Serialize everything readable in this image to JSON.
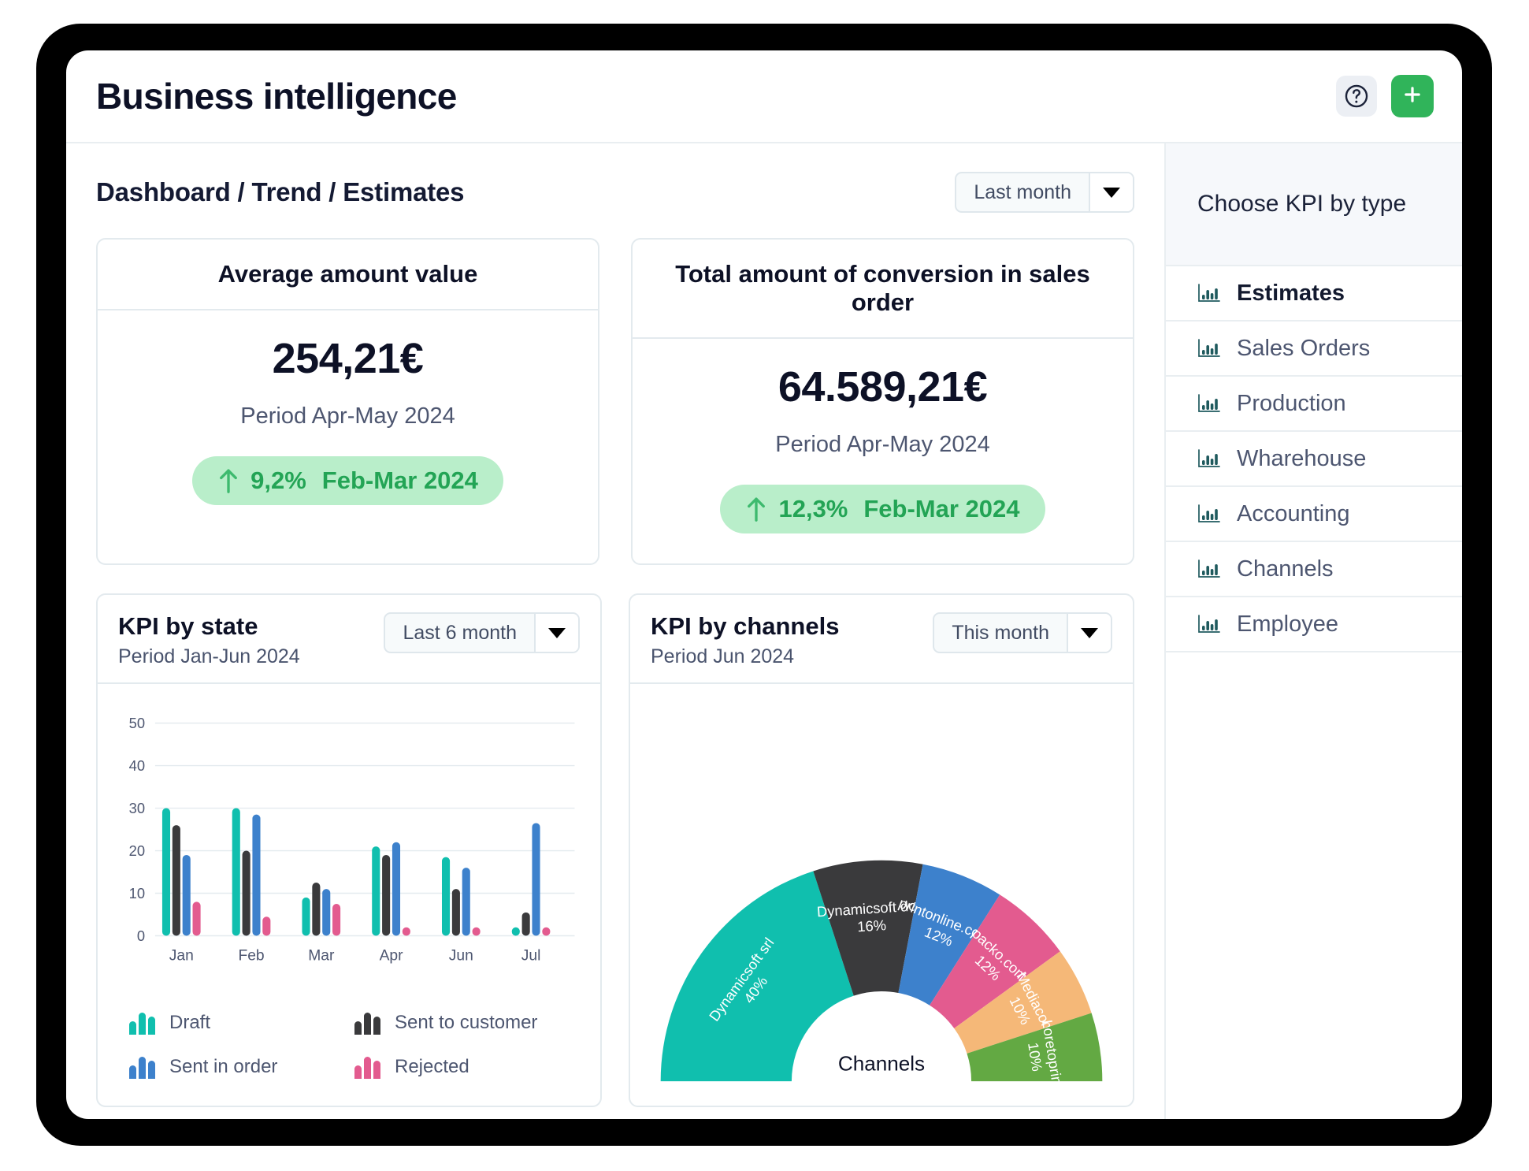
{
  "header": {
    "title": "Business intelligence",
    "help_icon": "question-circle-icon",
    "add_icon": "plus-icon"
  },
  "breadcrumb": "Dashboard / Trend / Estimates",
  "period_filter": {
    "value": "Last month",
    "arrow_icon": "chevron-down-icon"
  },
  "kpi_cards": [
    {
      "title": "Average amount value",
      "value": "254,21€",
      "period": "Period Apr-May 2024",
      "delta_pct": "9,2%",
      "delta_period": "Feb-Mar 2024",
      "delta_direction": "up",
      "delta_icon": "arrow-up-icon"
    },
    {
      "title": "Total amount of conversion in sales order",
      "value": "64.589,21€",
      "period": "Period Apr-May 2024",
      "delta_pct": "12,3%",
      "delta_period": "Feb-Mar 2024",
      "delta_direction": "up",
      "delta_icon": "arrow-up-icon"
    }
  ],
  "bar_card": {
    "title": "KPI by state",
    "subtitle": "Period Jan-Jun 2024",
    "filter": {
      "value": "Last 6 month",
      "arrow_icon": "chevron-down-icon"
    }
  },
  "donut_card": {
    "title": "KPI by channels",
    "subtitle": "Period Jun 2024",
    "filter": {
      "value": "This month",
      "arrow_icon": "chevron-down-icon"
    }
  },
  "sidebar": {
    "header": "Choose KPI by type",
    "items": [
      {
        "label": "Estimates",
        "icon": "bar-chart-icon",
        "active": true
      },
      {
        "label": "Sales Orders",
        "icon": "bar-chart-icon",
        "active": false
      },
      {
        "label": "Production",
        "icon": "bar-chart-icon",
        "active": false
      },
      {
        "label": "Wharehouse",
        "icon": "bar-chart-icon",
        "active": false
      },
      {
        "label": "Accounting",
        "icon": "bar-chart-icon",
        "active": false
      },
      {
        "label": "Channels",
        "icon": "bar-chart-icon",
        "active": false
      },
      {
        "label": "Employee",
        "icon": "bar-chart-icon",
        "active": false
      }
    ]
  },
  "colors": {
    "draft": "#10bfae",
    "sent_to_customer": "#3a3a3c",
    "sent_in_order": "#3d81cc",
    "rejected": "#e35b8f",
    "mediacom": "#f5b878",
    "loretoprint": "#63a943",
    "accent_green": "#30b45a",
    "badge_bg": "#b9eeca",
    "badge_text": "#23a455",
    "text_dark": "#0d1126",
    "text_muted": "#4d5670"
  },
  "chart_data": [
    {
      "type": "bar",
      "title": "KPI by state",
      "subtitle": "Period Jan-Jun 2024",
      "xlabel": "",
      "ylabel": "",
      "ylim": [
        0,
        50
      ],
      "yticks": [
        0,
        10,
        20,
        30,
        40,
        50
      ],
      "grid": true,
      "legend_position": "bottom",
      "categories": [
        "Jan",
        "Feb",
        "Mar",
        "Apr",
        "Jun",
        "Jul"
      ],
      "series": [
        {
          "name": "Draft",
          "color": "#10bfae",
          "values": [
            30,
            30,
            9,
            21,
            18.5,
            2
          ]
        },
        {
          "name": "Sent to customer",
          "color": "#3a3a3c",
          "values": [
            26,
            20,
            12.5,
            19,
            11,
            5.5
          ]
        },
        {
          "name": "Sent in order",
          "color": "#3d81cc",
          "values": [
            19,
            28.5,
            11,
            22,
            16,
            26.5
          ]
        },
        {
          "name": "Rejected",
          "color": "#e35b8f",
          "values": [
            8,
            4.5,
            7.5,
            2,
            2,
            2
          ]
        }
      ]
    },
    {
      "type": "pie",
      "variant": "half-donut",
      "title": "KPI by channels",
      "subtitle": "Period Jun 2024",
      "center_label": "Channels",
      "slices": [
        {
          "label": "Dynamicsoft srl",
          "value": 40,
          "display": "40%",
          "color": "#10bfae"
        },
        {
          "label": "Dynamicsoft doo",
          "value": 16,
          "display": "16%",
          "color": "#3a3a3c"
        },
        {
          "label": "printonline.com",
          "value": 12,
          "display": "12%",
          "color": "#3d81cc"
        },
        {
          "label": "packo.com",
          "value": 12,
          "display": "12%",
          "color": "#e35b8f"
        },
        {
          "label": "Mediacom",
          "value": 10,
          "display": "10%",
          "color": "#f5b878"
        },
        {
          "label": "Loretoprint",
          "value": 10,
          "display": "10%",
          "color": "#63a943"
        }
      ]
    }
  ]
}
